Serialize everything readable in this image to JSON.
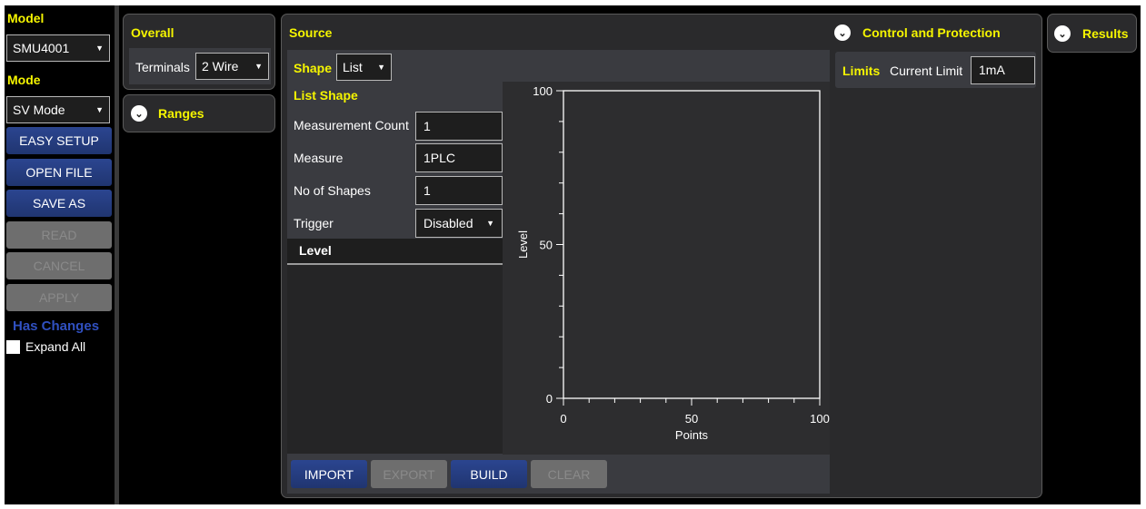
{
  "sidebar": {
    "model_label": "Model",
    "model_value": "SMU4001",
    "mode_label": "Mode",
    "mode_value": "SV Mode",
    "buttons": [
      "EASY SETUP",
      "OPEN FILE",
      "SAVE AS",
      "READ",
      "CANCEL",
      "APPLY"
    ],
    "has_changes": "Has Changes",
    "expand_all": "Expand All"
  },
  "overall": {
    "title": "Overall",
    "terminals_label": "Terminals",
    "terminals_value": "2 Wire"
  },
  "ranges": {
    "title": "Ranges"
  },
  "source": {
    "title": "Source",
    "shape_label": "Shape",
    "shape_value": "List",
    "list_shape": "List Shape",
    "fields": [
      {
        "label": "Measurement Count",
        "value": "1"
      },
      {
        "label": "Measure",
        "value": "1PLC"
      },
      {
        "label": "No of Shapes",
        "value": "1"
      },
      {
        "label": "Trigger",
        "value": "Disabled"
      }
    ],
    "level_header": "Level",
    "buttons": [
      "IMPORT",
      "EXPORT",
      "BUILD",
      "CLEAR"
    ]
  },
  "control": {
    "title": "Control and Protection",
    "limits_label": "Limits",
    "current_limit_label": "Current Limit",
    "current_limit_value": "1mA"
  },
  "results": {
    "title": "Results"
  },
  "chart_data": {
    "type": "line",
    "xlabel": "Points",
    "ylabel": "Level",
    "xlim": [
      0,
      100
    ],
    "ylim": [
      0,
      100
    ],
    "xticks": [
      "0",
      "50",
      "100"
    ],
    "yticks": [
      "0",
      "50",
      "100"
    ],
    "series": []
  }
}
